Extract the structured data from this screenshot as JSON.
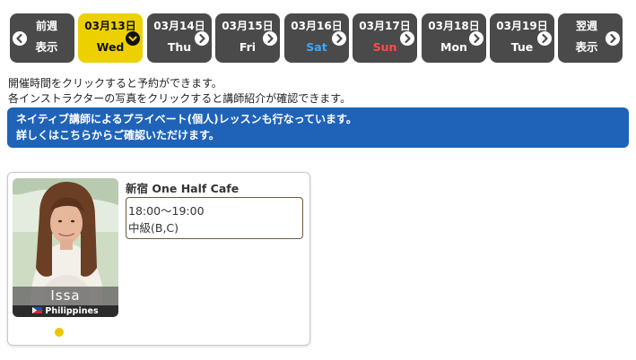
{
  "date_nav": {
    "prev": {
      "line1": "前週",
      "line2": "表示"
    },
    "days": [
      {
        "date": "03月13日",
        "weekday": "Wed",
        "active": true
      },
      {
        "date": "03月14日",
        "weekday": "Thu"
      },
      {
        "date": "03月15日",
        "weekday": "Fri"
      },
      {
        "date": "03月16日",
        "weekday": "Sat"
      },
      {
        "date": "03月17日",
        "weekday": "Sun"
      },
      {
        "date": "03月18日",
        "weekday": "Mon"
      },
      {
        "date": "03月19日",
        "weekday": "Tue"
      }
    ],
    "next": {
      "line1": "翌週",
      "line2": "表示"
    }
  },
  "notes": {
    "line1": "開催時間をクリックすると予約ができます。",
    "line2": "各インストラクターの写真をクリックすると講師紹介が確認できます。"
  },
  "banner": {
    "line1": "ネイティブ講師によるプライベート(個人)レッスンも行なっています。",
    "line2": "詳しくはこちらからご確認いただけます。"
  },
  "lesson_card": {
    "instructor_name": "Issa",
    "country": "Philippines",
    "venue": "新宿 One Half Cafe",
    "time": "18:00～19:00",
    "level": "中級(B,C)"
  },
  "colors": {
    "nav_bg": "#4a4a4a",
    "active_bg": "#ecd000",
    "banner_bg": "#1f63b8",
    "saturday": "#3aa8ff",
    "sunday": "#ff4a4a",
    "dot": "#e8c800"
  }
}
